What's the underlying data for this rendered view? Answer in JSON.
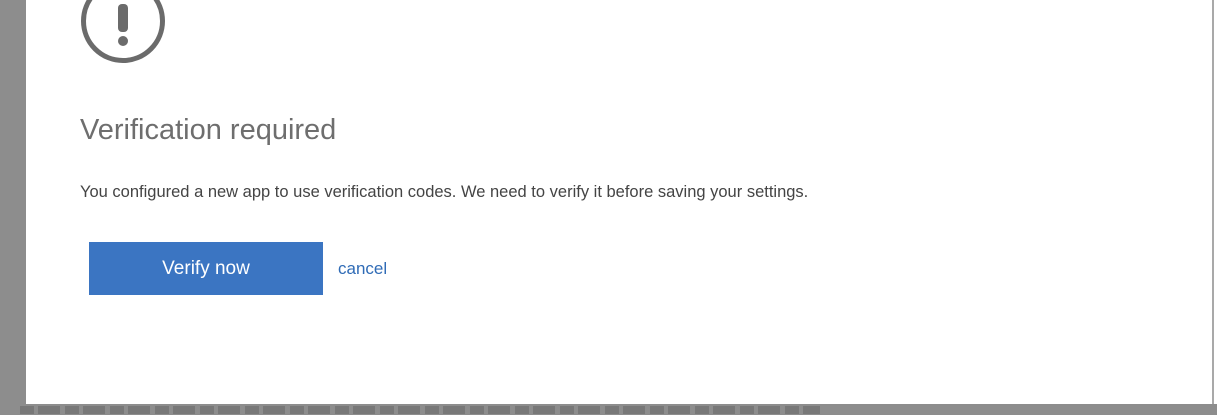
{
  "dialog": {
    "title": "Verification required",
    "message": "You configured a new app to use verification codes. We need to verify it before saving your settings.",
    "verify_button_label": "Verify now",
    "cancel_link_label": "cancel",
    "icon": "exclamation-circle-icon"
  },
  "colors": {
    "primary_button": "#3b75c2",
    "link": "#2f6bb6",
    "title_text": "#6e6e6e",
    "body_text": "#444444",
    "backdrop": "#8d8d8d"
  }
}
